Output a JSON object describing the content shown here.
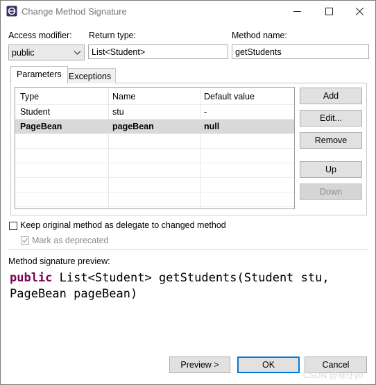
{
  "window": {
    "title": "Change Method Signature"
  },
  "form": {
    "access_modifier_label": "Access modifier:",
    "access_modifier_value": "public",
    "return_type_label": "Return type:",
    "return_type_value": "List<Student>",
    "method_name_label": "Method name:",
    "method_name_value": "getStudents"
  },
  "tabs": [
    {
      "label": "Parameters",
      "active": true
    },
    {
      "label": "Exceptions",
      "active": false
    }
  ],
  "table": {
    "columns": [
      "Type",
      "Name",
      "Default value"
    ],
    "rows": [
      {
        "type": "Student",
        "name": "stu",
        "default": "-"
      },
      {
        "type": "PageBean",
        "name": "pageBean",
        "default": "null",
        "selected": true
      }
    ]
  },
  "side_buttons": {
    "add": "Add",
    "edit": "Edit...",
    "remove": "Remove",
    "up": "Up",
    "down": "Down"
  },
  "options": {
    "keep_original_label": "Keep original method as delegate to changed method",
    "keep_original_checked": false,
    "mark_deprecated_label": "Mark as deprecated",
    "mark_deprecated_checked": true
  },
  "preview": {
    "label": "Method signature preview:",
    "keyword": "public",
    "signature": " List<Student> getStudents(Student stu,\nPageBean pageBean)"
  },
  "footer": {
    "preview_button": "Preview >",
    "ok_button": "OK",
    "cancel_button": "Cancel",
    "watermark": "CSDN @菲仔yo"
  },
  "colors": {
    "keyword": "#7f0055",
    "focus": "#0078d7",
    "selection": "#d9d9d9"
  }
}
